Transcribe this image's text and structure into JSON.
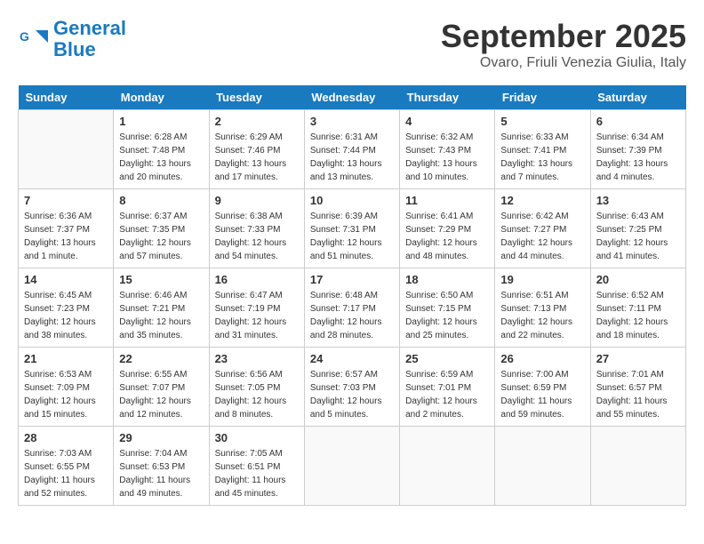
{
  "header": {
    "logo_line1": "General",
    "logo_line2": "Blue",
    "month": "September 2025",
    "location": "Ovaro, Friuli Venezia Giulia, Italy"
  },
  "days_of_week": [
    "Sunday",
    "Monday",
    "Tuesday",
    "Wednesday",
    "Thursday",
    "Friday",
    "Saturday"
  ],
  "weeks": [
    [
      null,
      {
        "num": "1",
        "sunrise": "6:28 AM",
        "sunset": "7:48 PM",
        "daylight": "13 hours and 20 minutes."
      },
      {
        "num": "2",
        "sunrise": "6:29 AM",
        "sunset": "7:46 PM",
        "daylight": "13 hours and 17 minutes."
      },
      {
        "num": "3",
        "sunrise": "6:31 AM",
        "sunset": "7:44 PM",
        "daylight": "13 hours and 13 minutes."
      },
      {
        "num": "4",
        "sunrise": "6:32 AM",
        "sunset": "7:43 PM",
        "daylight": "13 hours and 10 minutes."
      },
      {
        "num": "5",
        "sunrise": "6:33 AM",
        "sunset": "7:41 PM",
        "daylight": "13 hours and 7 minutes."
      },
      {
        "num": "6",
        "sunrise": "6:34 AM",
        "sunset": "7:39 PM",
        "daylight": "13 hours and 4 minutes."
      }
    ],
    [
      {
        "num": "7",
        "sunrise": "6:36 AM",
        "sunset": "7:37 PM",
        "daylight": "13 hours and 1 minute."
      },
      {
        "num": "8",
        "sunrise": "6:37 AM",
        "sunset": "7:35 PM",
        "daylight": "12 hours and 57 minutes."
      },
      {
        "num": "9",
        "sunrise": "6:38 AM",
        "sunset": "7:33 PM",
        "daylight": "12 hours and 54 minutes."
      },
      {
        "num": "10",
        "sunrise": "6:39 AM",
        "sunset": "7:31 PM",
        "daylight": "12 hours and 51 minutes."
      },
      {
        "num": "11",
        "sunrise": "6:41 AM",
        "sunset": "7:29 PM",
        "daylight": "12 hours and 48 minutes."
      },
      {
        "num": "12",
        "sunrise": "6:42 AM",
        "sunset": "7:27 PM",
        "daylight": "12 hours and 44 minutes."
      },
      {
        "num": "13",
        "sunrise": "6:43 AM",
        "sunset": "7:25 PM",
        "daylight": "12 hours and 41 minutes."
      }
    ],
    [
      {
        "num": "14",
        "sunrise": "6:45 AM",
        "sunset": "7:23 PM",
        "daylight": "12 hours and 38 minutes."
      },
      {
        "num": "15",
        "sunrise": "6:46 AM",
        "sunset": "7:21 PM",
        "daylight": "12 hours and 35 minutes."
      },
      {
        "num": "16",
        "sunrise": "6:47 AM",
        "sunset": "7:19 PM",
        "daylight": "12 hours and 31 minutes."
      },
      {
        "num": "17",
        "sunrise": "6:48 AM",
        "sunset": "7:17 PM",
        "daylight": "12 hours and 28 minutes."
      },
      {
        "num": "18",
        "sunrise": "6:50 AM",
        "sunset": "7:15 PM",
        "daylight": "12 hours and 25 minutes."
      },
      {
        "num": "19",
        "sunrise": "6:51 AM",
        "sunset": "7:13 PM",
        "daylight": "12 hours and 22 minutes."
      },
      {
        "num": "20",
        "sunrise": "6:52 AM",
        "sunset": "7:11 PM",
        "daylight": "12 hours and 18 minutes."
      }
    ],
    [
      {
        "num": "21",
        "sunrise": "6:53 AM",
        "sunset": "7:09 PM",
        "daylight": "12 hours and 15 minutes."
      },
      {
        "num": "22",
        "sunrise": "6:55 AM",
        "sunset": "7:07 PM",
        "daylight": "12 hours and 12 minutes."
      },
      {
        "num": "23",
        "sunrise": "6:56 AM",
        "sunset": "7:05 PM",
        "daylight": "12 hours and 8 minutes."
      },
      {
        "num": "24",
        "sunrise": "6:57 AM",
        "sunset": "7:03 PM",
        "daylight": "12 hours and 5 minutes."
      },
      {
        "num": "25",
        "sunrise": "6:59 AM",
        "sunset": "7:01 PM",
        "daylight": "12 hours and 2 minutes."
      },
      {
        "num": "26",
        "sunrise": "7:00 AM",
        "sunset": "6:59 PM",
        "daylight": "11 hours and 59 minutes."
      },
      {
        "num": "27",
        "sunrise": "7:01 AM",
        "sunset": "6:57 PM",
        "daylight": "11 hours and 55 minutes."
      }
    ],
    [
      {
        "num": "28",
        "sunrise": "7:03 AM",
        "sunset": "6:55 PM",
        "daylight": "11 hours and 52 minutes."
      },
      {
        "num": "29",
        "sunrise": "7:04 AM",
        "sunset": "6:53 PM",
        "daylight": "11 hours and 49 minutes."
      },
      {
        "num": "30",
        "sunrise": "7:05 AM",
        "sunset": "6:51 PM",
        "daylight": "11 hours and 45 minutes."
      },
      null,
      null,
      null,
      null
    ]
  ]
}
